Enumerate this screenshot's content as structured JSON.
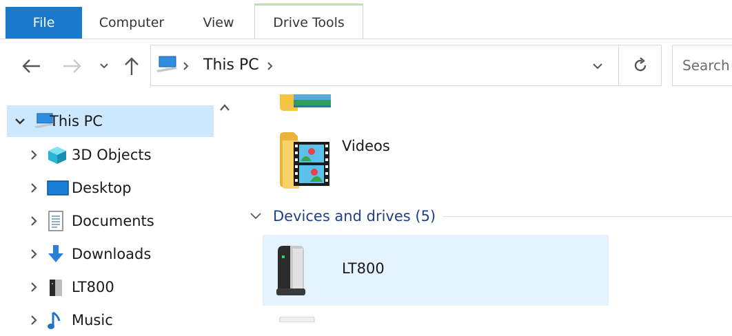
{
  "ribbon": {
    "tabs": [
      {
        "label": "File"
      },
      {
        "label": "Computer"
      },
      {
        "label": "View"
      },
      {
        "label": "Drive Tools"
      }
    ]
  },
  "address": {
    "crumb": "This PC",
    "search_placeholder": "Search"
  },
  "nav": {
    "items": [
      {
        "label": "This PC",
        "icon": "this-pc-icon"
      },
      {
        "label": "3D Objects",
        "icon": "3d-objects-icon"
      },
      {
        "label": "Desktop",
        "icon": "desktop-icon"
      },
      {
        "label": "Documents",
        "icon": "documents-icon"
      },
      {
        "label": "Downloads",
        "icon": "downloads-icon"
      },
      {
        "label": "LT800",
        "icon": "drive-icon"
      },
      {
        "label": "Music",
        "icon": "music-icon"
      }
    ]
  },
  "content": {
    "videos_label": "Videos",
    "devices_header": "Devices and drives (5)",
    "drive_label": "LT800"
  },
  "colors": {
    "file_tab": "#1979ca",
    "selection": "#cce8ff",
    "hover_tile": "#e5f3ff",
    "group_header": "#1e3f8a",
    "drive_tools_accent": "#b6e3a6"
  }
}
